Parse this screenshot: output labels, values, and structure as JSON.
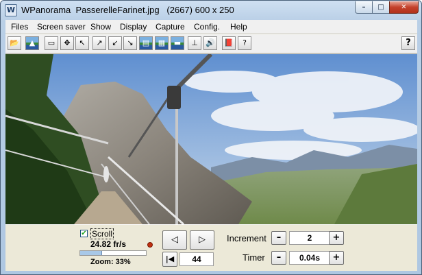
{
  "window": {
    "app_icon": "W",
    "title": "WPanorama  PasserelleFarinet.jpg   (2667) 600 x 250",
    "minimize": "–",
    "maximize": "□",
    "close": "✕"
  },
  "menu": [
    "Files",
    "Screen saver",
    "Show",
    "Display",
    "Capture",
    "Config.",
    "Help"
  ],
  "toolbar": {
    "icons": [
      "open-file-icon",
      "image-icon",
      "page-icon",
      "move-icon",
      "arrow-nw-icon",
      "arrow-ne-icon",
      "arrow-sw-icon",
      "arrow-se-icon",
      "panorama-view-icon",
      "panorama-landscape-icon",
      "panorama-strip-icon",
      "tripod-icon",
      "speaker-icon",
      "book-icon",
      "help-book-icon"
    ],
    "glyphs": [
      "📂",
      "▲",
      "▭",
      "✥",
      "↖",
      "↗",
      "↙",
      "↘",
      "▤",
      "▦",
      "▬",
      "⊥",
      "🔊",
      "📕",
      "?"
    ],
    "help": "?"
  },
  "controls": {
    "scroll_checked": true,
    "scroll_check_glyph": "✔",
    "scroll_label": "Scroll",
    "fps": "24.82 fr/s",
    "zoom_fraction": 0.33,
    "zoom_text": "Zoom: 33%",
    "prev_glyph": "◁",
    "next_glyph": "▷",
    "first_glyph": "|◀",
    "frame": "44",
    "increment_label": "Increment",
    "increment_value": "2",
    "timer_label": "Timer",
    "timer_value": "0.04s",
    "minus": "–",
    "plus": "+"
  },
  "colors": {
    "sky": "#6f9fd8",
    "cloud": "#eef2f8",
    "rock": "#8c8c8c",
    "valley": "#7f9a5c",
    "forest": "#2f4d22"
  }
}
